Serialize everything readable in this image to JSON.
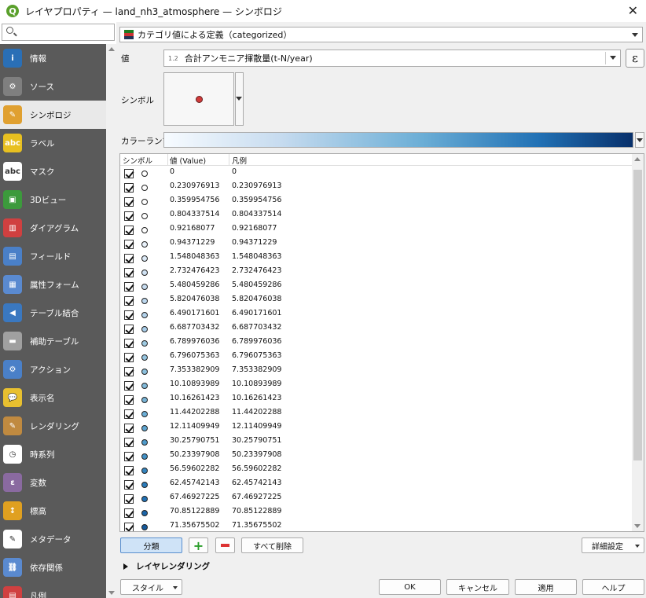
{
  "window": {
    "title": "レイヤプロパティ — land_nh3_atmosphere — シンボロジ"
  },
  "sidebar": {
    "items": [
      {
        "label": "情報",
        "icon": "info-icon",
        "color": "#2a6fb6",
        "glyph": "i"
      },
      {
        "label": "ソース",
        "icon": "source-wrench-icon",
        "color": "#7f7f7f",
        "glyph": "⚙"
      },
      {
        "label": "シンボロジ",
        "icon": "symbology-brush-icon",
        "color": "#e0a030",
        "glyph": "✎",
        "active": true
      },
      {
        "label": "ラベル",
        "icon": "labels-abc-icon",
        "color": "#e8c020",
        "glyph": "abc"
      },
      {
        "label": "マスク",
        "icon": "mask-abc-icon",
        "color": "#ffffff",
        "glyph": "abc"
      },
      {
        "label": "3Dビュー",
        "icon": "3d-cube-icon",
        "color": "#3c9a3c",
        "glyph": "▣"
      },
      {
        "label": "ダイアグラム",
        "icon": "diagram-icon",
        "color": "#d04040",
        "glyph": "▥"
      },
      {
        "label": "フィールド",
        "icon": "fields-icon",
        "color": "#4a80c8",
        "glyph": "▤"
      },
      {
        "label": "属性フォーム",
        "icon": "attribute-form-icon",
        "color": "#5a8ad0",
        "glyph": "▦"
      },
      {
        "label": "テーブル結合",
        "icon": "join-icon",
        "color": "#3a78c0",
        "glyph": "◀"
      },
      {
        "label": "補助テーブル",
        "icon": "auxiliary-storage-icon",
        "color": "#a0a0a0",
        "glyph": "▬"
      },
      {
        "label": "アクション",
        "icon": "action-gear-icon",
        "color": "#4a80c8",
        "glyph": "⚙"
      },
      {
        "label": "表示名",
        "icon": "display-tooltip-icon",
        "color": "#e8c030",
        "glyph": "💬"
      },
      {
        "label": "レンダリング",
        "icon": "rendering-brush-icon",
        "color": "#c08a40",
        "glyph": "✎"
      },
      {
        "label": "時系列",
        "icon": "temporal-clock-icon",
        "color": "#ffffff",
        "glyph": "◷"
      },
      {
        "label": "変数",
        "icon": "variables-epsilon-icon",
        "color": "#8a6aa0",
        "glyph": "ε"
      },
      {
        "label": "標高",
        "icon": "elevation-icon",
        "color": "#e0a020",
        "glyph": "↕"
      },
      {
        "label": "メタデータ",
        "icon": "metadata-icon",
        "color": "#ffffff",
        "glyph": "✎"
      },
      {
        "label": "依存関係",
        "icon": "dependencies-icon",
        "color": "#5a8ad0",
        "glyph": "⛓"
      },
      {
        "label": "凡例",
        "icon": "legend-icon",
        "color": "#d04040",
        "glyph": "▤"
      }
    ]
  },
  "renderer": {
    "label": "カテゴリ値による定義（categorized）"
  },
  "value": {
    "label": "値",
    "type": "1.2",
    "expression": "合計アンモニア揮散量(t-N/year)"
  },
  "symbol": {
    "label": "シンボル"
  },
  "ramp": {
    "label": "カラーランプ"
  },
  "table": {
    "headers": {
      "symbol": "シンボル",
      "value": "値 (Value)",
      "legend": "凡例"
    },
    "rows": [
      {
        "value": "0",
        "legend": "0",
        "color": "#ffffff"
      },
      {
        "value": "0.230976913",
        "legend": "0.230976913",
        "color": "#ffffff"
      },
      {
        "value": "0.359954756",
        "legend": "0.359954756",
        "color": "#ffffff"
      },
      {
        "value": "0.804337514",
        "legend": "0.804337514",
        "color": "#ffffff"
      },
      {
        "value": "0.92168077",
        "legend": "0.92168077",
        "color": "#ffffff"
      },
      {
        "value": "0.94371229",
        "legend": "0.94371229",
        "color": "#e8f1fa"
      },
      {
        "value": "1.548048363",
        "legend": "1.548048363",
        "color": "#dbe9f6"
      },
      {
        "value": "2.732476423",
        "legend": "2.732476423",
        "color": "#cfe1f2"
      },
      {
        "value": "5.480459286",
        "legend": "5.480459286",
        "color": "#c6dbef"
      },
      {
        "value": "5.820476038",
        "legend": "5.820476038",
        "color": "#bcd7ee"
      },
      {
        "value": "6.490171601",
        "legend": "6.490171601",
        "color": "#b2d2eb"
      },
      {
        "value": "6.687703432",
        "legend": "6.687703432",
        "color": "#a8cde9"
      },
      {
        "value": "6.789976036",
        "legend": "6.789976036",
        "color": "#9ecae1"
      },
      {
        "value": "6.796075363",
        "legend": "6.796075363",
        "color": "#95c4df"
      },
      {
        "value": "7.353382909",
        "legend": "7.353382909",
        "color": "#8bbfdc"
      },
      {
        "value": "10.10893989",
        "legend": "10.10893989",
        "color": "#81b9d9"
      },
      {
        "value": "10.16261423",
        "legend": "10.16261423",
        "color": "#77b3d6"
      },
      {
        "value": "11.44202288",
        "legend": "11.44202288",
        "color": "#6baed6"
      },
      {
        "value": "12.11409949",
        "legend": "12.11409949",
        "color": "#5da4d0"
      },
      {
        "value": "30.25790751",
        "legend": "30.25790751",
        "color": "#4f9aca"
      },
      {
        "value": "50.23397908",
        "legend": "50.23397908",
        "color": "#4290c5"
      },
      {
        "value": "56.59602282",
        "legend": "56.59602282",
        "color": "#3585bf"
      },
      {
        "value": "62.45742143",
        "legend": "62.45742143",
        "color": "#2b7bba"
      },
      {
        "value": "67.46927225",
        "legend": "67.46927225",
        "color": "#2171b5"
      },
      {
        "value": "70.85122889",
        "legend": "70.85122889",
        "color": "#1b65a8"
      },
      {
        "value": "71.35675502",
        "legend": "71.35675502",
        "color": "#15599b"
      }
    ]
  },
  "buttons": {
    "classify": "分類",
    "delete_all": "すべて削除",
    "advanced": "詳細設定",
    "style": "スタイル",
    "ok": "OK",
    "cancel": "キャンセル",
    "apply": "適用",
    "help": "ヘルプ"
  },
  "layer_rendering": {
    "label": "レイヤレンダリング"
  }
}
